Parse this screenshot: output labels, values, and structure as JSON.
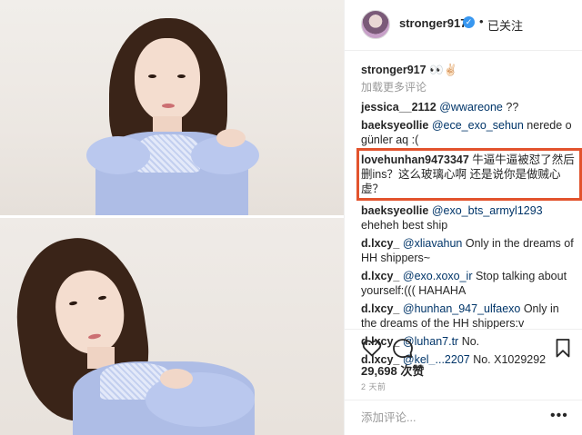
{
  "header": {
    "username": "stronger917",
    "verified_glyph": "✓",
    "separator": "•",
    "follow_status": "已关注"
  },
  "caption": {
    "username": "stronger917",
    "text": "👀✌🏻"
  },
  "load_more": "加载更多评论",
  "comments": [
    {
      "user": "jessica__2112",
      "mention": "@wwareone",
      "text": " ??"
    },
    {
      "user": "baeksyeollie",
      "mention": "@ece_exo_sehun",
      "text": " nerede o günler aq :("
    },
    {
      "user": "lovehunhan9473347",
      "mention": "",
      "text": " 牛逼牛逼被怼了然后删ins？这么玻璃心啊 还是说你是做贼心虚？"
    },
    {
      "user": "baeksyeollie",
      "mention": "@exo_bts_armyl1293",
      "text": " eheheh best ship"
    },
    {
      "user": "d.lxcy_",
      "mention": "@xliavahun",
      "text": " Only in the dreams of HH shippers~"
    },
    {
      "user": "d.lxcy_",
      "mention": "@exo.xoxo_ir",
      "text": " Stop talking about yourself:((( HAHAHA"
    },
    {
      "user": "d.lxcy_",
      "mention": "@hunhan_947_ulfaexo",
      "text": " Only in the dreams of the HH shippers:v"
    },
    {
      "user": "d.lxcy_",
      "mention": "@luhan7.tr",
      "text": " No."
    },
    {
      "user": "d.lxcy_",
      "mention": "@kel_...2207",
      "text": " No. X1029292"
    }
  ],
  "likes": "29,698 次赞",
  "time_ago": "2 天前",
  "add_comment": {
    "placeholder": "添加评论..."
  },
  "more_glyph": "•••",
  "colors": {
    "highlight_box": "#e2532d",
    "verified": "#3897f0",
    "muted_text": "#999999",
    "mention": "#003569"
  },
  "icons": [
    "verified-badge-icon",
    "heart-icon",
    "comment-icon",
    "bookmark-icon",
    "more-icon"
  ]
}
